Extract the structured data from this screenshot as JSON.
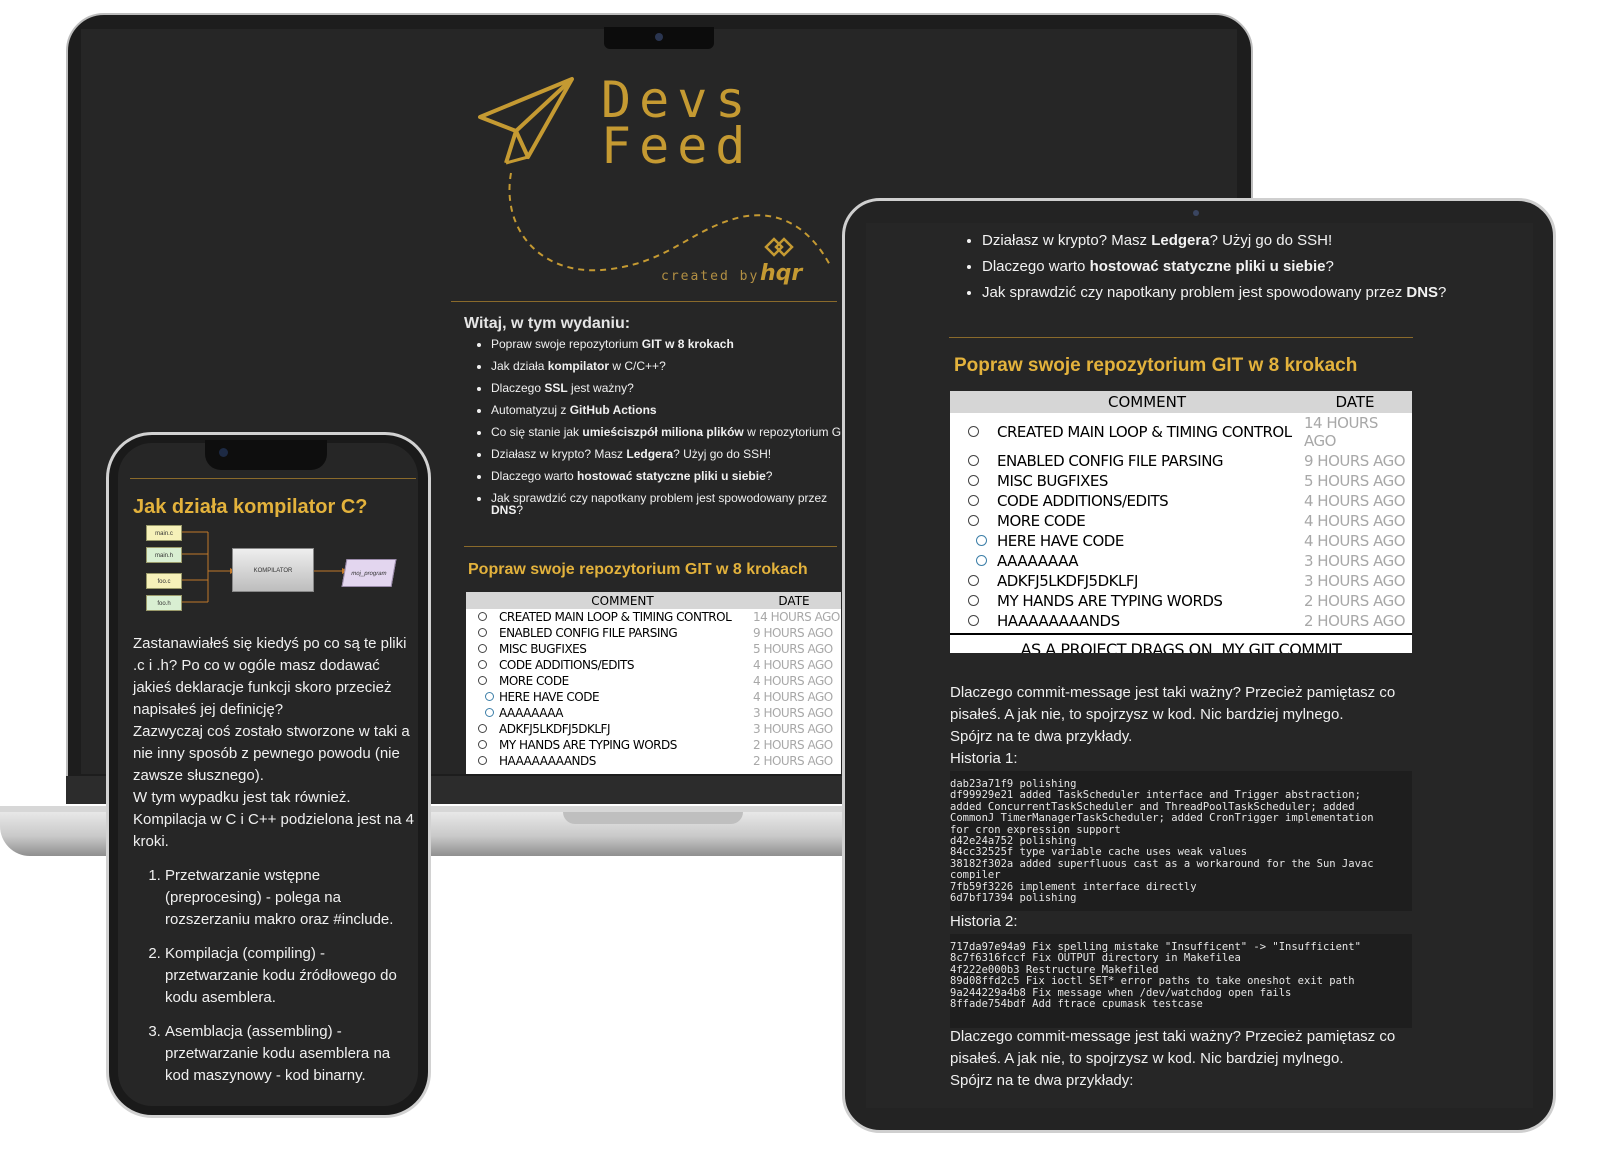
{
  "logo": {
    "line1": "Devs",
    "line2": "Feed",
    "created_by": "created by:",
    "brand": "hqr"
  },
  "newsletter": {
    "intro": "Witaj, w tym wydaniu:",
    "toc": [
      {
        "before": "Popraw swoje repozytorium ",
        "bold": "GIT w 8 krokach",
        "after": ""
      },
      {
        "before": "Jak działa ",
        "bold": "kompilator",
        "after": " w C/C++?"
      },
      {
        "before": "Dlaczego ",
        "bold": "SSL",
        "after": " jest ważny?"
      },
      {
        "before": "Automatyzuj z ",
        "bold": "GitHub Actions",
        "after": ""
      },
      {
        "before": "Co się stanie jak ",
        "bold": "umieściszpół miliona plików",
        "after": " w repozytorium GIT?"
      },
      {
        "before": "Działasz w krypto? Masz ",
        "bold": "Ledgera",
        "after": "? Użyj go do SSH!"
      },
      {
        "before": "Dlaczego warto ",
        "bold": "hostować statyczne pliki u siebie",
        "after": "?"
      },
      {
        "before": "Jak sprawdzić czy napotkany problem jest spowodowany przez ",
        "bold": "DNS",
        "after": "?"
      }
    ],
    "section_title": "Popraw swoje repozytorium GIT w 8 krokach"
  },
  "comic": {
    "header_comment": "COMMENT",
    "header_date": "DATE",
    "rows": [
      {
        "comment": "CREATED MAIN LOOP & TIMING CONTROL",
        "date": "14 HOURS AGO"
      },
      {
        "comment": "ENABLED CONFIG FILE PARSING",
        "date": "9 HOURS AGO"
      },
      {
        "comment": "MISC BUGFIXES",
        "date": "5 HOURS AGO"
      },
      {
        "comment": "CODE ADDITIONS/EDITS",
        "date": "4 HOURS AGO"
      },
      {
        "comment": "MORE CODE",
        "date": "4 HOURS AGO"
      },
      {
        "comment": "HERE HAVE CODE",
        "date": "4 HOURS AGO"
      },
      {
        "comment": "AAAAAAAA",
        "date": "3 HOURS AGO"
      },
      {
        "comment": "ADKFJ5LKDFJ5DKLFJ",
        "date": "3 HOURS AGO"
      },
      {
        "comment": "MY HANDS ARE TYPING WORDS",
        "date": "2 HOURS AGO"
      },
      {
        "comment": "HAAAAAAAANDS",
        "date": "2 HOURS AGO"
      }
    ],
    "caption": "AS A PROJECT DRAGS ON, MY GIT COMMIT MESSAGES GET LESS AND LESS INFORMATIVE."
  },
  "tablet": {
    "toc_tail": [
      {
        "before": "Działasz w krypto? Masz ",
        "bold": "Ledgera",
        "after": "? Użyj go do SSH!"
      },
      {
        "before": "Dlaczego warto ",
        "bold": "hostować statyczne pliki u siebie",
        "after": "?"
      },
      {
        "before": "Jak sprawdzić czy napotkany problem jest spowodowany przez ",
        "bold": "DNS",
        "after": "?"
      }
    ],
    "section_title": "Popraw swoje repozytorium GIT w 8 krokach",
    "paragraph": "Dlaczego commit-message jest taki ważny? Przecież pamiętasz co pisałeś. A jak nie, to spojrzysz w kod. Nic bardziej mylnego.",
    "paragraph2": "Spójrz na te dwa przykłady.",
    "history1_label": "Historia 1:",
    "history1": "dab23a71f9 polishing\ndf99929e21 added TaskScheduler interface and Trigger abstraction;\nadded ConcurrentTaskScheduler and ThreadPoolTaskScheduler; added\nCommonJ TimerManagerTaskScheduler; added CronTrigger implementation\nfor cron expression support\nd42e24a752 polishing\n84cc32525f type variable cache uses weak values\n38182f302a added superfluous cast as a workaround for the Sun Javac\ncompiler\n7fb59f3226 implement interface directly\n6d7bf17394 polishing",
    "history2_label": "Historia 2:",
    "history2": "717da97e94a9 Fix spelling mistake \"Insufficent\" -> \"Insufficient\"\n8c7f6316fccf Fix OUTPUT directory in Makefilea\n4f222e000b3 Restructure Makefiled\n89d08ffd2c5 Fix ioctl SET* error paths to take oneshot exit path\n9a244229a4b8 Fix message when /dev/watchdog open fails\n8ffade754bdf Add ftrace cpumask testcase",
    "paragraph3": "Dlaczego commit-message jest taki ważny? Przecież pamiętasz co pisałeś. A jak nie, to spojrzysz w kod. Nic bardziej mylnego.",
    "paragraph4": "Spójrz na te dwa przykłady:"
  },
  "phone": {
    "title": "Jak działa kompilator C?",
    "diagram": {
      "files": [
        "main.c",
        "main.h",
        "foo.c",
        "foo.h"
      ],
      "compiler": "KOMPILATOR",
      "output": "moj_program"
    },
    "paragraphs": [
      "Zastanawiałeś się kiedyś po co są te pliki .c i .h? Po co w ogóle masz dodawać jakieś deklaracje funkcji skoro przecież napisałeś jej definicję?",
      "Zazwyczaj coś zostało stworzone w taki a nie inny sposób z pewnego powodu (nie zawsze słusznego).",
      "W tym wypadku jest tak również.",
      "Kompilacja w C i C++ podzielona jest na 4 kroki."
    ],
    "steps": [
      "Przetwarzanie wstępne (preprocesing) - polega na rozszerzaniu makro oraz #include.",
      "Kompilacja (compiling) - przetwarzanie kodu źródłowego do kodu asemblera.",
      "Asemblacja (assembling) - przetwarzanie kodu asemblera na kod maszynowy - kod binarny."
    ]
  },
  "colors": {
    "gold": "#e3b23c",
    "background": "#262626",
    "text": "#f0f0f0"
  }
}
